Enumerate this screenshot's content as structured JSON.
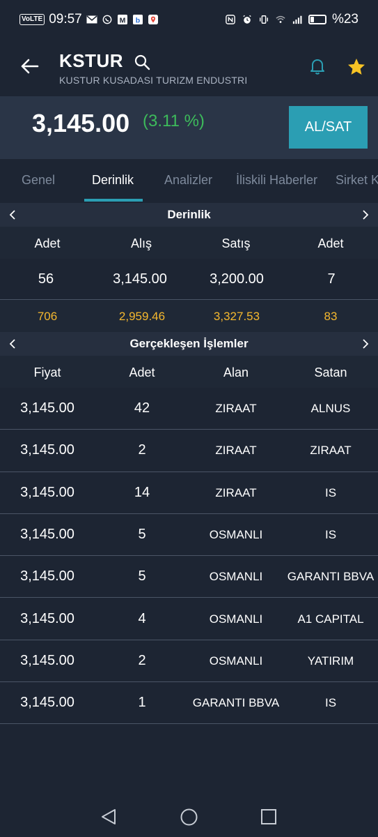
{
  "status": {
    "time": "09:57",
    "volte": "VoLTE",
    "battery": "%23",
    "battery_level": 0.23
  },
  "header": {
    "ticker": "KSTUR",
    "company": "KUSTUR KUSADASI TURIZM ENDUSTRI"
  },
  "quote": {
    "price": "3,145.00",
    "change": "(3.11 %)",
    "trade_button": "AL/SAT"
  },
  "tabs": [
    "Genel",
    "Derinlik",
    "Analizler",
    "İliskili Haberler",
    "Sirket K"
  ],
  "depth": {
    "title": "Derinlik",
    "columns": [
      "Adet",
      "Alış",
      "Satış",
      "Adet"
    ],
    "row": [
      "56",
      "3,145.00",
      "3,200.00",
      "7"
    ],
    "totals": [
      "706",
      "2,959.46",
      "3,327.53",
      "83"
    ]
  },
  "trades": {
    "title": "Gerçekleşen İşlemler",
    "columns": [
      "Fiyat",
      "Adet",
      "Alan",
      "Satan"
    ],
    "rows": [
      [
        "3,145.00",
        "42",
        "ZIRAAT",
        "ALNUS"
      ],
      [
        "3,145.00",
        "2",
        "ZIRAAT",
        "ZIRAAT"
      ],
      [
        "3,145.00",
        "14",
        "ZIRAAT",
        "IS"
      ],
      [
        "3,145.00",
        "5",
        "OSMANLI",
        "IS"
      ],
      [
        "3,145.00",
        "5",
        "OSMANLI",
        "GARANTI BBVA"
      ],
      [
        "3,145.00",
        "4",
        "OSMANLI",
        "A1 CAPITAL"
      ],
      [
        "3,145.00",
        "2",
        "OSMANLI",
        "YATIRIM"
      ],
      [
        "3,145.00",
        "1",
        "GARANTI BBVA",
        "IS"
      ]
    ]
  },
  "colors": {
    "background": "#1d2533",
    "accent": "#2b9eb3",
    "positive": "#3dbb5b",
    "highlight": "#f5b82e",
    "star": "#f7c325"
  }
}
